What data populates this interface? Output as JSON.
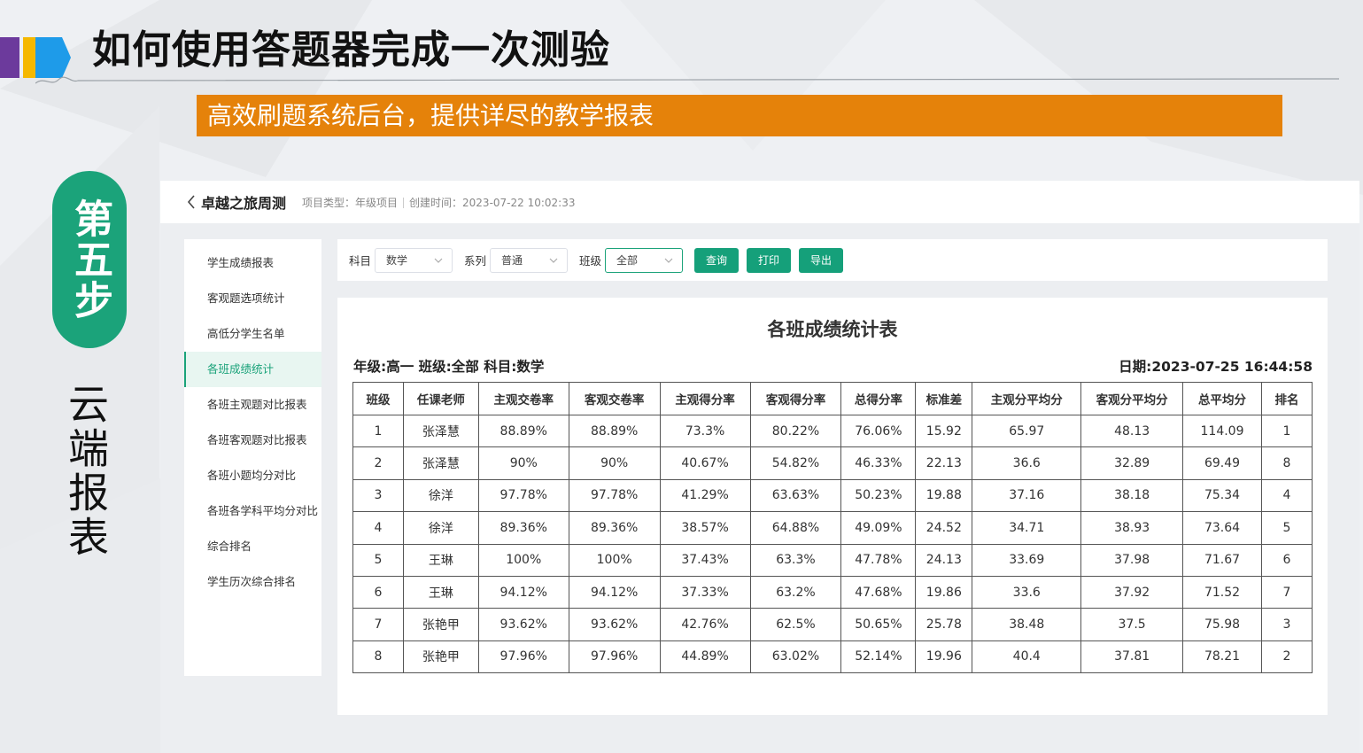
{
  "slide": {
    "title": "如何使用答题器完成一次测验",
    "subtitle": "高效刷题系统后台，提供详尽的教学报表",
    "step": "第五步",
    "caption": "云端报表",
    "colors": {
      "title_bar_purple": "#6c3a9c",
      "title_bar_yellow": "#f5b800",
      "title_bar_blue": "#1e9be9",
      "banner": "#e5820a",
      "step_pill": "#1ba37a"
    }
  },
  "app": {
    "back_icon": "chevron-left-icon",
    "project_name": "卓越之旅周测",
    "meta_type": "项目类型：年级项目",
    "meta_created": "创建时间：2023-07-22 10:02:33",
    "sidebar": [
      {
        "label": "学生成绩报表",
        "active": false
      },
      {
        "label": "客观题选项统计",
        "active": false
      },
      {
        "label": "高低分学生名单",
        "active": false
      },
      {
        "label": "各班成绩统计",
        "active": true
      },
      {
        "label": "各班主观题对比报表",
        "active": false
      },
      {
        "label": "各班客观题对比报表",
        "active": false
      },
      {
        "label": "各班小题均分对比",
        "active": false
      },
      {
        "label": "各班各学科平均分对比",
        "active": false
      },
      {
        "label": "综合排名",
        "active": false
      },
      {
        "label": "学生历次综合排名",
        "active": false
      }
    ],
    "filters": {
      "subject_label": "科目",
      "subject_value": "数学",
      "series_label": "系列",
      "series_value": "普通",
      "class_label": "班级",
      "class_value": "全部",
      "query_button": "查询",
      "print_button": "打印",
      "export_button": "导出"
    },
    "report": {
      "title": "各班成绩统计表",
      "info": "年级:高一 班级:全部 科目:数学",
      "date": "日期:2023-07-25 16:44:58",
      "columns": [
        "班级",
        "任课老师",
        "主观交卷率",
        "客观交卷率",
        "主观得分率",
        "客观得分率",
        "总得分率",
        "标准差",
        "主观分平均分",
        "客观分平均分",
        "总平均分",
        "排名"
      ],
      "rows": [
        [
          "1",
          "张泽慧",
          "88.89%",
          "88.89%",
          "73.3%",
          "80.22%",
          "76.06%",
          "15.92",
          "65.97",
          "48.13",
          "114.09",
          "1"
        ],
        [
          "2",
          "张泽慧",
          "90%",
          "90%",
          "40.67%",
          "54.82%",
          "46.33%",
          "22.13",
          "36.6",
          "32.89",
          "69.49",
          "8"
        ],
        [
          "3",
          "徐洋",
          "97.78%",
          "97.78%",
          "41.29%",
          "63.63%",
          "50.23%",
          "19.88",
          "37.16",
          "38.18",
          "75.34",
          "4"
        ],
        [
          "4",
          "徐洋",
          "89.36%",
          "89.36%",
          "38.57%",
          "64.88%",
          "49.09%",
          "24.52",
          "34.71",
          "38.93",
          "73.64",
          "5"
        ],
        [
          "5",
          "王琳",
          "100%",
          "100%",
          "37.43%",
          "63.3%",
          "47.78%",
          "24.13",
          "33.69",
          "37.98",
          "71.67",
          "6"
        ],
        [
          "6",
          "王琳",
          "94.12%",
          "94.12%",
          "37.33%",
          "63.2%",
          "47.68%",
          "19.86",
          "33.6",
          "37.92",
          "71.52",
          "7"
        ],
        [
          "7",
          "张艳甲",
          "93.62%",
          "93.62%",
          "42.76%",
          "62.5%",
          "50.65%",
          "25.78",
          "38.48",
          "37.5",
          "75.98",
          "3"
        ],
        [
          "8",
          "张艳甲",
          "97.96%",
          "97.96%",
          "44.89%",
          "63.02%",
          "52.14%",
          "19.96",
          "40.4",
          "37.81",
          "78.21",
          "2"
        ]
      ]
    }
  }
}
